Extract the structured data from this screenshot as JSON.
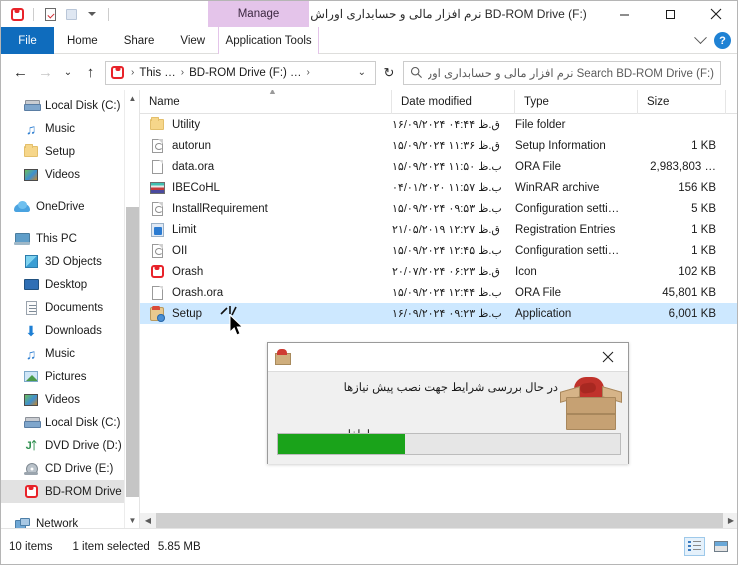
{
  "window": {
    "title": "BD-ROM Drive (F:) نرم افزار مالی و حسابداری اوراش",
    "manage_context_label": "Manage",
    "minimize_label": "─",
    "maximize_label": "□",
    "close_label": "✕"
  },
  "quick_access_toolbar": {
    "items": [
      {
        "name": "bdrom-drive-icon",
        "label": ""
      },
      {
        "name": "properties-icon",
        "label": ""
      },
      {
        "name": "new-folder-icon",
        "label": ""
      },
      {
        "name": "customize-caret-icon",
        "label": ""
      }
    ]
  },
  "ribbon": {
    "tabs": [
      {
        "label": "File",
        "active": true
      },
      {
        "label": "Home",
        "active": false
      },
      {
        "label": "Share",
        "active": false
      },
      {
        "label": "View",
        "active": false
      },
      {
        "label": "Application Tools",
        "active": false
      }
    ],
    "expand_label": "",
    "help_label": "?"
  },
  "addressbar": {
    "back_label": "←",
    "forward_label": "→",
    "recent_label": "⌄",
    "up_label": "↑",
    "breadcrumbs": [
      {
        "label": "This …"
      },
      {
        "label": "BD-ROM Drive (F:) …"
      }
    ],
    "separator": "›",
    "dropdown_label": "⌄",
    "refresh_label": "↻",
    "search_placeholder": "Search BD-ROM Drive (F:) نرم افزار مالی و حسابداری اورا..."
  },
  "sidebar": {
    "groups": [
      {
        "items": [
          {
            "label": "Local Disk (C:)",
            "icon": "hard-drive-icon",
            "indent": 1,
            "selected": false
          },
          {
            "label": "Music",
            "icon": "music-icon",
            "indent": 1,
            "selected": false
          },
          {
            "label": "Setup",
            "icon": "folder-icon",
            "indent": 1,
            "selected": false
          },
          {
            "label": "Videos",
            "icon": "video-icon",
            "indent": 1,
            "selected": false
          }
        ]
      },
      {
        "items": [
          {
            "label": "OneDrive",
            "icon": "cloud-icon",
            "indent": 0,
            "selected": false
          }
        ]
      },
      {
        "items": [
          {
            "label": "This PC",
            "icon": "pc-icon",
            "indent": 0,
            "selected": false
          },
          {
            "label": "3D Objects",
            "icon": "3d-objects-icon",
            "indent": 1,
            "selected": false
          },
          {
            "label": "Desktop",
            "icon": "desktop-icon",
            "indent": 1,
            "selected": false
          },
          {
            "label": "Documents",
            "icon": "documents-icon",
            "indent": 1,
            "selected": false
          },
          {
            "label": "Downloads",
            "icon": "downloads-icon",
            "indent": 1,
            "selected": false
          },
          {
            "label": "Music",
            "icon": "music-icon",
            "indent": 1,
            "selected": false
          },
          {
            "label": "Pictures",
            "icon": "pictures-icon",
            "indent": 1,
            "selected": false
          },
          {
            "label": "Videos",
            "icon": "video-icon",
            "indent": 1,
            "selected": false
          },
          {
            "label": "Local Disk (C:)",
            "icon": "hard-drive-icon",
            "indent": 1,
            "selected": false
          },
          {
            "label": "DVD Drive (D:) J|",
            "icon": "dvd-drive-icon",
            "indent": 1,
            "selected": false
          },
          {
            "label": "CD Drive (E:)",
            "icon": "cd-drive-icon",
            "indent": 1,
            "selected": false
          },
          {
            "label": "BD-ROM Drive (",
            "icon": "bdrom-drive-icon",
            "indent": 1,
            "selected": true
          }
        ]
      },
      {
        "items": [
          {
            "label": "Network",
            "icon": "network-icon",
            "indent": 0,
            "selected": false
          }
        ]
      }
    ]
  },
  "filelist": {
    "columns": [
      {
        "label": "Name",
        "key": "name"
      },
      {
        "label": "Date modified",
        "key": "date"
      },
      {
        "label": "Type",
        "key": "type"
      },
      {
        "label": "Size",
        "key": "size"
      }
    ],
    "rows": [
      {
        "name": "Utility",
        "date": "۱۶/۰۹/۲۰۲۴ ق.ظ ۰۴:۴۴",
        "type": "File folder",
        "size": "",
        "icon": "folder-icon",
        "selected": false
      },
      {
        "name": "autorun",
        "date": "۱۵/۰۹/۲۰۲۴ ق.ظ ۱۱:۳۶",
        "type": "Setup Information",
        "size": "1 KB",
        "icon": "inf-file-icon",
        "selected": false
      },
      {
        "name": "data.ora",
        "date": "۱۵/۰۹/۲۰۲۴ ب.ظ ۱۱:۵۰",
        "type": "ORA File",
        "size": "2,983,803 …",
        "icon": "blank-file-icon",
        "selected": false
      },
      {
        "name": "IBECoHL",
        "date": "۰۴/۰۱/۲۰۲۰ ب.ظ ۱۱:۵۷",
        "type": "WinRAR archive",
        "size": "156 KB",
        "icon": "winrar-icon",
        "selected": false
      },
      {
        "name": "InstallRequirement",
        "date": "۱۵/۰۹/۲۰۲۴ ب.ظ ۰۹:۵۳",
        "type": "Configuration setti…",
        "size": "5 KB",
        "icon": "inf-file-icon",
        "selected": false
      },
      {
        "name": "Limit",
        "date": "۲۱/۰۵/۲۰۱۹ ق.ظ ۱۲:۲۷",
        "type": "Registration Entries",
        "size": "1 KB",
        "icon": "registry-icon",
        "selected": false
      },
      {
        "name": "OII",
        "date": "۱۵/۰۹/۲۰۲۴ ب.ظ ۱۲:۴۵",
        "type": "Configuration setti…",
        "size": "1 KB",
        "icon": "inf-file-icon",
        "selected": false
      },
      {
        "name": "Orash",
        "date": "۲۰/۰۷/۲۰۲۴ ق.ظ ۰۶:۲۳",
        "type": "Icon",
        "size": "102 KB",
        "icon": "bdrom-drive-icon",
        "selected": false
      },
      {
        "name": "Orash.ora",
        "date": "۱۵/۰۹/۲۰۲۴ ب.ظ ۱۲:۴۴",
        "type": "ORA File",
        "size": "45,801 KB",
        "icon": "blank-file-icon",
        "selected": false
      },
      {
        "name": "Setup",
        "date": "۱۶/۰۹/۲۰۲۴ ب.ظ ۰۹:۲۳",
        "type": "Application",
        "size": "6,001 KB",
        "icon": "setup-app-icon",
        "selected": true
      }
    ]
  },
  "statusbar": {
    "item_count": "10 items",
    "selection_count": "1 item selected",
    "selection_size": "5.85 MB",
    "view_details_label": "",
    "view_large_icons_label": ""
  },
  "dialog": {
    "title": "",
    "close_label": "✕",
    "message_line1": "در حال بررسی شرایط جهت نصب پیش نیازها",
    "message_line2": "لطفا صبر",
    "progress_percent": 37,
    "progress_color": "#1aa31a"
  },
  "colors": {
    "file_tab_blue": "#0f6cbd",
    "manage_purple": "#e4c4ea",
    "selection_blue": "#cde8ff",
    "accent_red": "#e8232a"
  }
}
